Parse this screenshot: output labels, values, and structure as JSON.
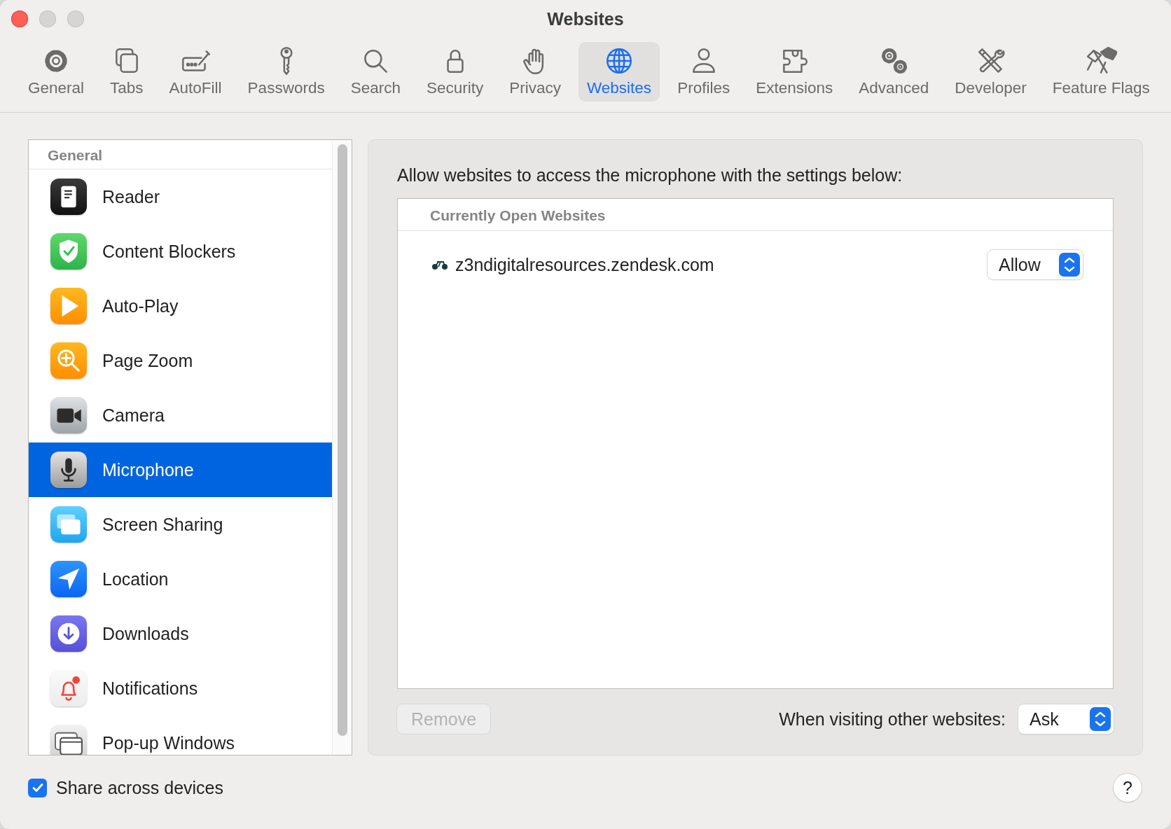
{
  "window": {
    "title": "Websites"
  },
  "toolbar": [
    {
      "label": "General",
      "selected": false
    },
    {
      "label": "Tabs",
      "selected": false
    },
    {
      "label": "AutoFill",
      "selected": false
    },
    {
      "label": "Passwords",
      "selected": false
    },
    {
      "label": "Search",
      "selected": false
    },
    {
      "label": "Security",
      "selected": false
    },
    {
      "label": "Privacy",
      "selected": false
    },
    {
      "label": "Websites",
      "selected": true
    },
    {
      "label": "Profiles",
      "selected": false
    },
    {
      "label": "Extensions",
      "selected": false
    },
    {
      "label": "Advanced",
      "selected": false
    },
    {
      "label": "Developer",
      "selected": false
    },
    {
      "label": "Feature Flags",
      "selected": false
    }
  ],
  "sidebar": {
    "section": "General",
    "items": [
      {
        "label": "Reader",
        "selected": false
      },
      {
        "label": "Content Blockers",
        "selected": false
      },
      {
        "label": "Auto-Play",
        "selected": false
      },
      {
        "label": "Page Zoom",
        "selected": false
      },
      {
        "label": "Camera",
        "selected": false
      },
      {
        "label": "Microphone",
        "selected": true
      },
      {
        "label": "Screen Sharing",
        "selected": false
      },
      {
        "label": "Location",
        "selected": false
      },
      {
        "label": "Downloads",
        "selected": false
      },
      {
        "label": "Notifications",
        "selected": false
      },
      {
        "label": "Pop-up Windows",
        "selected": false
      }
    ]
  },
  "panel": {
    "description": "Allow websites to access the microphone with the settings below:",
    "table": {
      "header": "Currently Open Websites",
      "rows": [
        {
          "site": "z3ndigitalresources.zendesk.com",
          "permission": "Allow"
        }
      ]
    },
    "remove_button": {
      "label": "Remove",
      "disabled": true
    },
    "other_websites": {
      "label": "When visiting other websites:",
      "value": "Ask"
    }
  },
  "share_across_devices": {
    "label": "Share across devices",
    "checked": true
  },
  "help_button": "?"
}
